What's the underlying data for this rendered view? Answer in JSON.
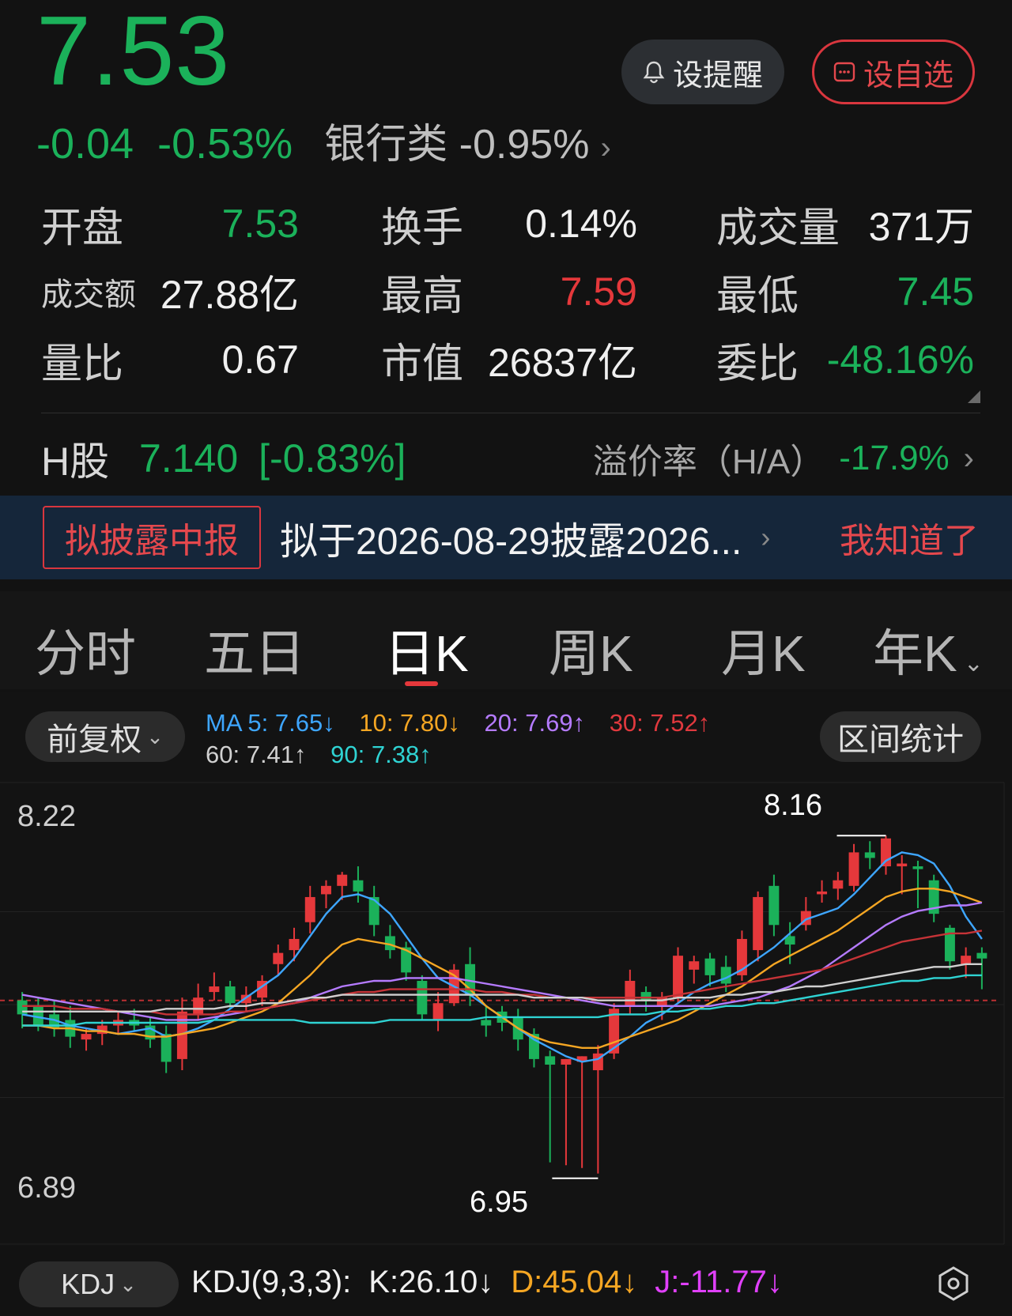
{
  "quote": {
    "price": "7.53",
    "change": "-0.04",
    "change_pct": "-0.53%",
    "sector_name": "银行类",
    "sector_change": "-0.95%",
    "price_color": "#1bb15a"
  },
  "actions": {
    "alert_label": "设提醒",
    "watchlist_label": "设自选"
  },
  "stats": {
    "open_label": "开盘",
    "open": "7.53",
    "turnover_label": "换手",
    "turnover": "0.14%",
    "volume_label": "成交量",
    "volume": "371万",
    "amount_label": "成交额",
    "amount": "27.88亿",
    "high_label": "最高",
    "high": "7.59",
    "low_label": "最低",
    "low": "7.45",
    "vol_ratio_label": "量比",
    "vol_ratio": "0.67",
    "mkt_cap_label": "市值",
    "mkt_cap": "26837亿",
    "order_ratio_label": "委比",
    "order_ratio": "-48.16%"
  },
  "hshare": {
    "label": "H股",
    "price": "7.140",
    "change_pct": "[-0.83%]",
    "premium_label": "溢价率（H/A）",
    "premium": "-17.9%"
  },
  "banner": {
    "tag": "拟披露中报",
    "text": "拟于2026-08-29披露2026...",
    "dismiss": "我知道了"
  },
  "tabs": [
    {
      "label": "分时"
    },
    {
      "label": "五日"
    },
    {
      "label": "日K"
    },
    {
      "label": "周K"
    },
    {
      "label": "月K"
    },
    {
      "label": "年K"
    }
  ],
  "chart_toolbar": {
    "adjust_label": "前复权",
    "range_stats_label": "区间统计"
  },
  "ma_legend": {
    "ma5": "MA 5: 7.65↓",
    "ma10": "10: 7.80↓",
    "ma20": "20: 7.69↑",
    "ma30": "30: 7.52↑",
    "ma60": "60: 7.41↑",
    "ma90": "90: 7.38↑"
  },
  "chart_data": {
    "type": "candlestick",
    "y_axis_top": "8.22",
    "y_axis_bottom": "6.89",
    "ylim": [
      6.89,
      8.22
    ],
    "high_marker": "8.16",
    "low_marker": "6.95",
    "ref_line": 7.57,
    "up_color": "#e5383b",
    "down_color": "#1bb15a",
    "candles": [
      {
        "o": 7.57,
        "h": 7.6,
        "l": 7.47,
        "c": 7.52
      },
      {
        "o": 7.55,
        "h": 7.58,
        "l": 7.46,
        "c": 7.48
      },
      {
        "o": 7.52,
        "h": 7.57,
        "l": 7.44,
        "c": 7.47
      },
      {
        "o": 7.5,
        "h": 7.55,
        "l": 7.4,
        "c": 7.44
      },
      {
        "o": 7.43,
        "h": 7.47,
        "l": 7.39,
        "c": 7.45
      },
      {
        "o": 7.45,
        "h": 7.5,
        "l": 7.41,
        "c": 7.48
      },
      {
        "o": 7.48,
        "h": 7.53,
        "l": 7.45,
        "c": 7.5
      },
      {
        "o": 7.5,
        "h": 7.54,
        "l": 7.46,
        "c": 7.48
      },
      {
        "o": 7.48,
        "h": 7.51,
        "l": 7.4,
        "c": 7.43
      },
      {
        "o": 7.45,
        "h": 7.48,
        "l": 7.31,
        "c": 7.35
      },
      {
        "o": 7.36,
        "h": 7.58,
        "l": 7.32,
        "c": 7.53
      },
      {
        "o": 7.52,
        "h": 7.63,
        "l": 7.5,
        "c": 7.58
      },
      {
        "o": 7.6,
        "h": 7.67,
        "l": 7.57,
        "c": 7.62
      },
      {
        "o": 7.62,
        "h": 7.64,
        "l": 7.54,
        "c": 7.56
      },
      {
        "o": 7.56,
        "h": 7.62,
        "l": 7.53,
        "c": 7.59
      },
      {
        "o": 7.58,
        "h": 7.66,
        "l": 7.55,
        "c": 7.64
      },
      {
        "o": 7.7,
        "h": 7.77,
        "l": 7.66,
        "c": 7.74
      },
      {
        "o": 7.75,
        "h": 7.83,
        "l": 7.71,
        "c": 7.79
      },
      {
        "o": 7.85,
        "h": 7.98,
        "l": 7.81,
        "c": 7.94
      },
      {
        "o": 7.95,
        "h": 8.0,
        "l": 7.9,
        "c": 7.98
      },
      {
        "o": 7.98,
        "h": 8.03,
        "l": 7.93,
        "c": 8.02
      },
      {
        "o": 8.0,
        "h": 8.05,
        "l": 7.92,
        "c": 7.96
      },
      {
        "o": 7.94,
        "h": 7.98,
        "l": 7.8,
        "c": 7.84
      },
      {
        "o": 7.8,
        "h": 7.84,
        "l": 7.72,
        "c": 7.75
      },
      {
        "o": 7.76,
        "h": 7.78,
        "l": 7.64,
        "c": 7.67
      },
      {
        "o": 7.64,
        "h": 7.66,
        "l": 7.5,
        "c": 7.52
      },
      {
        "o": 7.5,
        "h": 7.6,
        "l": 7.46,
        "c": 7.56
      },
      {
        "o": 7.56,
        "h": 7.7,
        "l": 7.55,
        "c": 7.68
      },
      {
        "o": 7.7,
        "h": 7.76,
        "l": 7.55,
        "c": 7.59
      },
      {
        "o": 7.5,
        "h": 7.55,
        "l": 7.44,
        "c": 7.48
      },
      {
        "o": 7.53,
        "h": 7.55,
        "l": 7.46,
        "c": 7.49
      },
      {
        "o": 7.51,
        "h": 7.54,
        "l": 7.39,
        "c": 7.43
      },
      {
        "o": 7.45,
        "h": 7.47,
        "l": 7.33,
        "c": 7.36
      },
      {
        "o": 7.37,
        "h": 7.39,
        "l": 6.99,
        "c": 7.34
      },
      {
        "o": 7.34,
        "h": 7.36,
        "l": 6.98,
        "c": 7.36
      },
      {
        "o": 7.35,
        "h": 7.37,
        "l": 6.97,
        "c": 7.37
      },
      {
        "o": 7.32,
        "h": 7.41,
        "l": 6.95,
        "c": 7.38
      },
      {
        "o": 7.38,
        "h": 7.56,
        "l": 7.36,
        "c": 7.54
      },
      {
        "o": 7.55,
        "h": 7.68,
        "l": 7.52,
        "c": 7.64
      },
      {
        "o": 7.6,
        "h": 7.62,
        "l": 7.53,
        "c": 7.57
      },
      {
        "o": 7.55,
        "h": 7.6,
        "l": 7.5,
        "c": 7.58
      },
      {
        "o": 7.58,
        "h": 7.76,
        "l": 7.56,
        "c": 7.73
      },
      {
        "o": 7.68,
        "h": 7.73,
        "l": 7.63,
        "c": 7.71
      },
      {
        "o": 7.72,
        "h": 7.74,
        "l": 7.62,
        "c": 7.66
      },
      {
        "o": 7.69,
        "h": 7.73,
        "l": 7.6,
        "c": 7.63
      },
      {
        "o": 7.66,
        "h": 7.82,
        "l": 7.64,
        "c": 7.79
      },
      {
        "o": 7.75,
        "h": 7.96,
        "l": 7.71,
        "c": 7.94
      },
      {
        "o": 7.98,
        "h": 8.02,
        "l": 7.8,
        "c": 7.84
      },
      {
        "o": 7.8,
        "h": 7.85,
        "l": 7.7,
        "c": 7.77
      },
      {
        "o": 7.84,
        "h": 7.94,
        "l": 7.82,
        "c": 7.89
      },
      {
        "o": 7.95,
        "h": 8.0,
        "l": 7.92,
        "c": 7.96
      },
      {
        "o": 7.97,
        "h": 8.03,
        "l": 7.93,
        "c": 8.0
      },
      {
        "o": 7.98,
        "h": 8.13,
        "l": 7.96,
        "c": 8.1
      },
      {
        "o": 8.1,
        "h": 8.14,
        "l": 8.04,
        "c": 8.08
      },
      {
        "o": 8.05,
        "h": 8.16,
        "l": 8.02,
        "c": 8.15
      },
      {
        "o": 8.05,
        "h": 8.09,
        "l": 7.95,
        "c": 8.06
      },
      {
        "o": 8.05,
        "h": 8.07,
        "l": 7.9,
        "c": 8.04
      },
      {
        "o": 8.0,
        "h": 8.02,
        "l": 7.85,
        "c": 7.88
      },
      {
        "o": 7.83,
        "h": 7.84,
        "l": 7.68,
        "c": 7.71
      },
      {
        "o": 7.7,
        "h": 7.76,
        "l": 7.65,
        "c": 7.73
      },
      {
        "o": 7.74,
        "h": 7.76,
        "l": 7.61,
        "c": 7.72
      }
    ],
    "ma_lines": [
      {
        "name": "MA5",
        "color": "#3ea6ff",
        "values": [
          7.52,
          7.51,
          7.5,
          7.48,
          7.47,
          7.46,
          7.45,
          7.46,
          7.47,
          7.44,
          7.45,
          7.47,
          7.5,
          7.54,
          7.58,
          7.62,
          7.66,
          7.72,
          7.8,
          7.88,
          7.94,
          7.95,
          7.93,
          7.88,
          7.8,
          7.72,
          7.65,
          7.62,
          7.59,
          7.55,
          7.51,
          7.47,
          7.43,
          7.4,
          7.37,
          7.35,
          7.36,
          7.4,
          7.44,
          7.49,
          7.52,
          7.56,
          7.6,
          7.63,
          7.65,
          7.68,
          7.72,
          7.76,
          7.81,
          7.86,
          7.88,
          7.9,
          7.95,
          8.01,
          8.07,
          8.1,
          8.09,
          8.06,
          7.98,
          7.87,
          7.79
        ]
      },
      {
        "name": "MA10",
        "color": "#f5a623",
        "values": [
          7.48,
          7.48,
          7.47,
          7.47,
          7.46,
          7.46,
          7.45,
          7.45,
          7.44,
          7.44,
          7.45,
          7.46,
          7.47,
          7.49,
          7.51,
          7.53,
          7.56,
          7.61,
          7.66,
          7.72,
          7.77,
          7.79,
          7.78,
          7.77,
          7.75,
          7.72,
          7.69,
          7.66,
          7.61,
          7.55,
          7.51,
          7.47,
          7.44,
          7.42,
          7.41,
          7.4,
          7.4,
          7.42,
          7.44,
          7.46,
          7.48,
          7.5,
          7.53,
          7.56,
          7.59,
          7.62,
          7.66,
          7.7,
          7.73,
          7.76,
          7.79,
          7.82,
          7.86,
          7.9,
          7.94,
          7.96,
          7.97,
          7.97,
          7.96,
          7.94,
          7.92
        ]
      },
      {
        "name": "MA20",
        "color": "#b57bff",
        "values": [
          7.59,
          7.58,
          7.57,
          7.56,
          7.55,
          7.54,
          7.53,
          7.52,
          7.51,
          7.5,
          7.5,
          7.5,
          7.51,
          7.52,
          7.53,
          7.54,
          7.55,
          7.56,
          7.58,
          7.6,
          7.62,
          7.63,
          7.64,
          7.64,
          7.65,
          7.65,
          7.65,
          7.65,
          7.64,
          7.63,
          7.62,
          7.61,
          7.6,
          7.59,
          7.58,
          7.57,
          7.56,
          7.55,
          7.55,
          7.55,
          7.55,
          7.55,
          7.55,
          7.55,
          7.56,
          7.57,
          7.58,
          7.6,
          7.62,
          7.65,
          7.68,
          7.72,
          7.76,
          7.8,
          7.84,
          7.87,
          7.89,
          7.9,
          7.91,
          7.91,
          7.92
        ]
      },
      {
        "name": "MA30",
        "color": "#c53337",
        "values": [
          7.55,
          7.55,
          7.55,
          7.54,
          7.54,
          7.54,
          7.53,
          7.53,
          7.53,
          7.52,
          7.52,
          7.52,
          7.52,
          7.53,
          7.53,
          7.54,
          7.55,
          7.56,
          7.57,
          7.58,
          7.59,
          7.6,
          7.6,
          7.61,
          7.61,
          7.61,
          7.61,
          7.61,
          7.61,
          7.6,
          7.6,
          7.59,
          7.59,
          7.58,
          7.58,
          7.58,
          7.58,
          7.58,
          7.58,
          7.58,
          7.58,
          7.59,
          7.6,
          7.61,
          7.62,
          7.63,
          7.64,
          7.65,
          7.66,
          7.67,
          7.68,
          7.7,
          7.72,
          7.74,
          7.76,
          7.78,
          7.79,
          7.8,
          7.81,
          7.81,
          7.82
        ]
      },
      {
        "name": "MA60",
        "color": "#d0d0d0",
        "values": [
          7.53,
          7.53,
          7.53,
          7.53,
          7.53,
          7.53,
          7.53,
          7.53,
          7.53,
          7.54,
          7.54,
          7.54,
          7.54,
          7.55,
          7.55,
          7.56,
          7.56,
          7.57,
          7.58,
          7.58,
          7.59,
          7.59,
          7.59,
          7.59,
          7.59,
          7.59,
          7.59,
          7.59,
          7.59,
          7.59,
          7.59,
          7.59,
          7.58,
          7.58,
          7.58,
          7.58,
          7.57,
          7.57,
          7.57,
          7.57,
          7.57,
          7.58,
          7.58,
          7.58,
          7.59,
          7.59,
          7.6,
          7.6,
          7.61,
          7.62,
          7.62,
          7.63,
          7.64,
          7.65,
          7.66,
          7.67,
          7.68,
          7.69,
          7.69,
          7.7,
          7.7
        ]
      },
      {
        "name": "MA90",
        "color": "#2fd3d3",
        "values": [
          7.48,
          7.48,
          7.48,
          7.48,
          7.49,
          7.49,
          7.49,
          7.49,
          7.49,
          7.49,
          7.49,
          7.49,
          7.5,
          7.5,
          7.5,
          7.5,
          7.5,
          7.5,
          7.49,
          7.49,
          7.49,
          7.49,
          7.49,
          7.5,
          7.5,
          7.5,
          7.5,
          7.5,
          7.5,
          7.51,
          7.51,
          7.51,
          7.51,
          7.51,
          7.51,
          7.51,
          7.51,
          7.52,
          7.52,
          7.52,
          7.53,
          7.53,
          7.54,
          7.54,
          7.55,
          7.55,
          7.56,
          7.56,
          7.57,
          7.58,
          7.59,
          7.6,
          7.61,
          7.62,
          7.63,
          7.64,
          7.64,
          7.65,
          7.65,
          7.66,
          7.66
        ]
      }
    ]
  },
  "kdj": {
    "selector": "KDJ",
    "params": "KDJ(9,3,3):",
    "k": "K:26.10↓",
    "d": "D:45.04↓",
    "j": "J:-11.77↓"
  }
}
